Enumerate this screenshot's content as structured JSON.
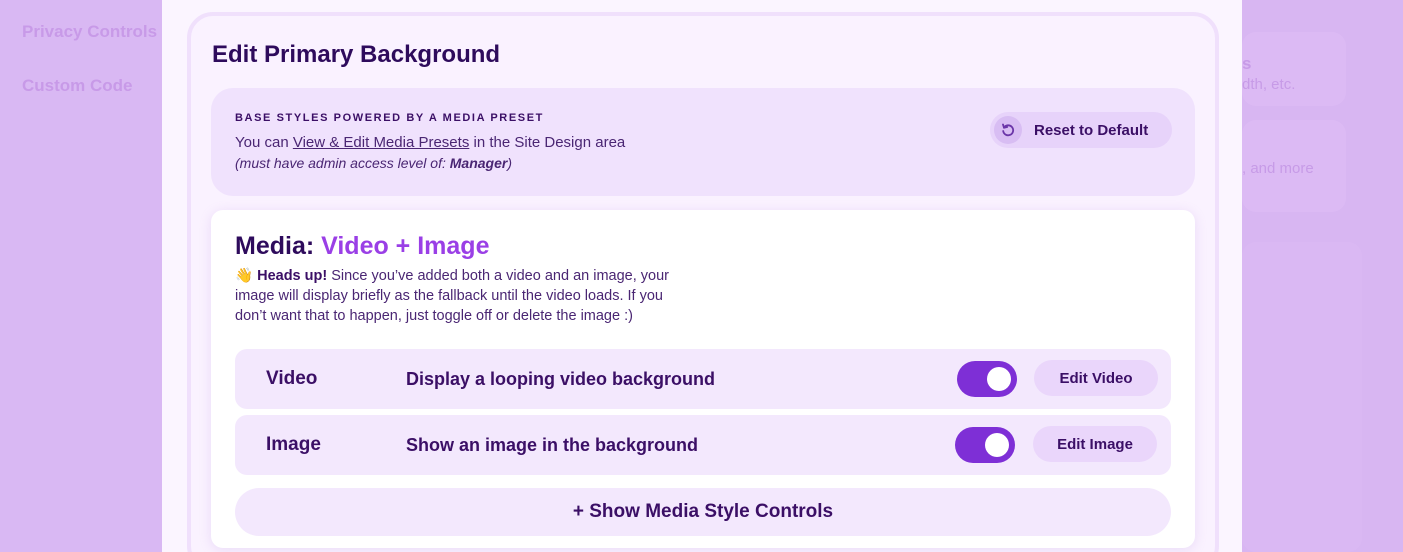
{
  "background_sidebar": {
    "items": [
      "Privacy Controls",
      "Custom Code"
    ]
  },
  "background_right": {
    "fragments": [
      "s",
      "dth, etc.",
      ", and more"
    ]
  },
  "modal": {
    "title": "Edit Primary Background",
    "preset": {
      "eyebrow": "BASE STYLES POWERED BY A MEDIA PRESET",
      "line_prefix": "You can ",
      "link_text": "View & Edit Media Presets",
      "line_suffix": " in the Site Design area",
      "note_prefix": "(must have admin access level of: ",
      "note_level": "Manager",
      "note_suffix": ")",
      "reset_label": "Reset to Default"
    },
    "media": {
      "heading_prefix": "Media: ",
      "heading_type": "Video + Image",
      "heads_up_emoji": "👋",
      "heads_up_bold": "Heads up!",
      "heads_up_text": " Since you’ve added both a video and an image, your image will display briefly as the fallback until the video loads. If you don’t want that to happen, just toggle off or delete the image :)",
      "rows": [
        {
          "label": "Video",
          "description": "Display a looping video background",
          "enabled": true,
          "button": "Edit Video"
        },
        {
          "label": "Image",
          "description": "Show an image in the background",
          "enabled": true,
          "button": "Edit Image"
        }
      ],
      "show_controls_label": "+ Show Media Style Controls"
    }
  },
  "colors": {
    "accent": "#9a3fe6",
    "toggle_on": "#7e2fd6",
    "text_dark": "#2e0b5c",
    "backdrop": "#d9b8f3"
  }
}
